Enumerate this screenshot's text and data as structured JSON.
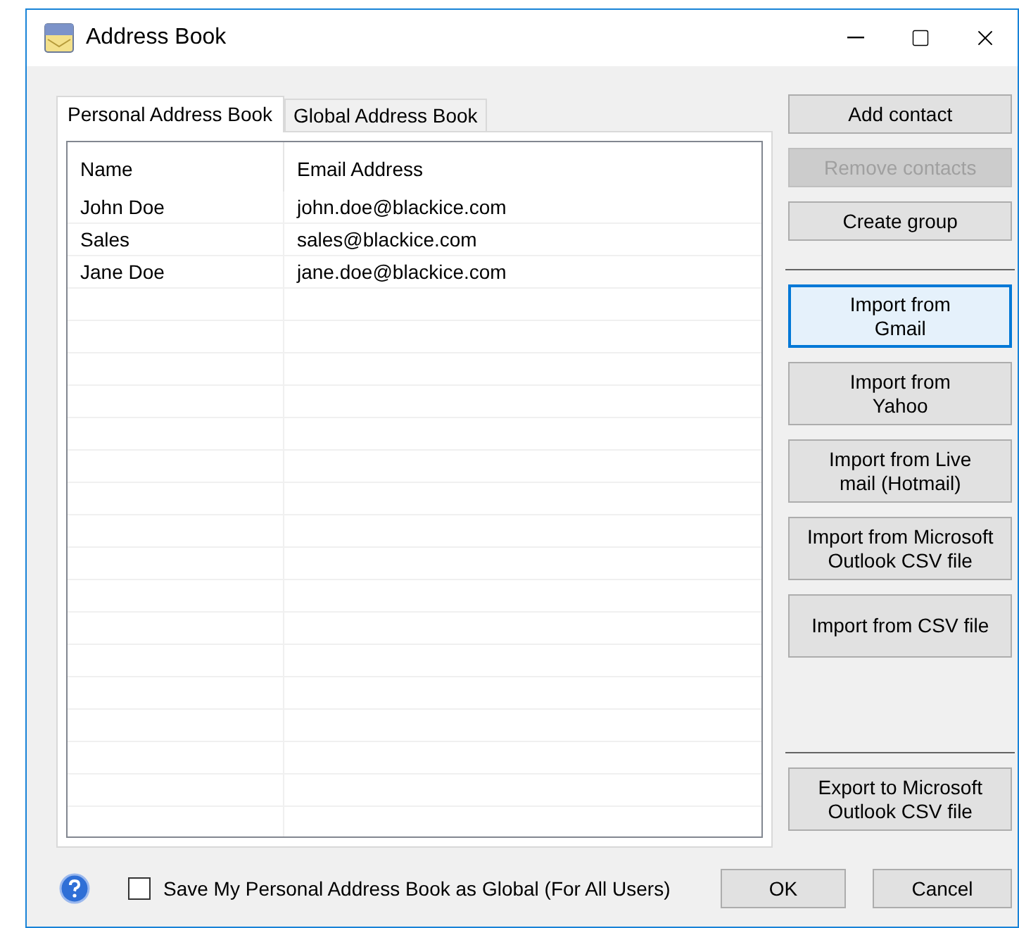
{
  "window": {
    "title": "Address Book"
  },
  "tabs": [
    {
      "label": "Personal Address Book",
      "selected": true
    },
    {
      "label": "Global Address Book",
      "selected": false
    }
  ],
  "table": {
    "columns": [
      "Name",
      "Email Address"
    ],
    "rows": [
      [
        "John Doe",
        "john.doe@blackice.com"
      ],
      [
        "Sales",
        "sales@blackice.com"
      ],
      [
        "Jane Doe",
        "jane.doe@blackice.com"
      ]
    ]
  },
  "side_buttons": [
    {
      "kind": "button",
      "label": "Add contact",
      "disabled": false,
      "focused": false
    },
    {
      "kind": "button",
      "label": "Remove contacts",
      "disabled": true,
      "focused": false
    },
    {
      "kind": "button",
      "label": "Create group",
      "disabled": false,
      "focused": false
    },
    {
      "kind": "separator"
    },
    {
      "kind": "button",
      "label": "Import from\nGmail",
      "disabled": false,
      "focused": true
    },
    {
      "kind": "button",
      "label": "Import from\nYahoo",
      "disabled": false,
      "focused": false
    },
    {
      "kind": "button",
      "label": "Import from Live\nmail (Hotmail)",
      "disabled": false,
      "focused": false
    },
    {
      "kind": "button",
      "label": "Import from Microsoft\nOutlook CSV file",
      "disabled": false,
      "focused": false
    },
    {
      "kind": "button",
      "label": "Import from CSV file",
      "disabled": false,
      "focused": false
    },
    {
      "kind": "spacer"
    },
    {
      "kind": "separator"
    },
    {
      "kind": "button",
      "label": "Export to Microsoft\nOutlook CSV file",
      "disabled": false,
      "focused": false
    }
  ],
  "save_global": {
    "label": "Save My Personal Address Book as Global (For All Users)",
    "checked": false
  },
  "dialog_buttons": [
    "OK",
    "Cancel"
  ]
}
